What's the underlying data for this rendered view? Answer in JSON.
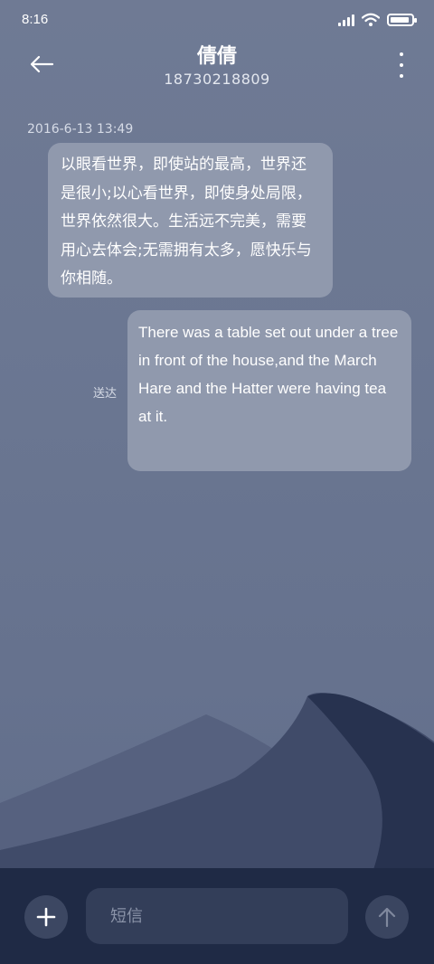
{
  "status_bar": {
    "time": "8:16",
    "battery_level": 0.9,
    "icons": [
      "cellular-signal-icon",
      "wifi-icon",
      "battery-icon"
    ]
  },
  "header": {
    "title": "倩倩",
    "subtitle": "18730218809",
    "back_icon": "arrow-left-icon",
    "more_icon": "more-vertical-icon"
  },
  "messages": [
    {
      "direction": "incoming",
      "timestamp": "2016-6-13 13:49",
      "text": "以眼看世界，即使站的最高，世界还是很小;以心看世界，即使身处局限，世界依然很大。生活远不完美，需要用心去体会;无需拥有太多，愿快乐与你相随。"
    },
    {
      "direction": "outgoing",
      "status": "送达",
      "text": "There was a table set out under a tree in front of the house,and the March Hare and the Hatter were having tea at it."
    }
  ],
  "composer": {
    "placeholder": "短信",
    "value": "",
    "add_icon": "plus-icon",
    "send_icon": "arrow-up-icon"
  },
  "colors": {
    "background": "#6b7792",
    "bubble": "#9099ad",
    "input_bar": "#1f2a45",
    "input_field": "#333e59",
    "button": "#3c4762",
    "dune_dark": "#27324f",
    "dune_light": "#4b5674"
  }
}
